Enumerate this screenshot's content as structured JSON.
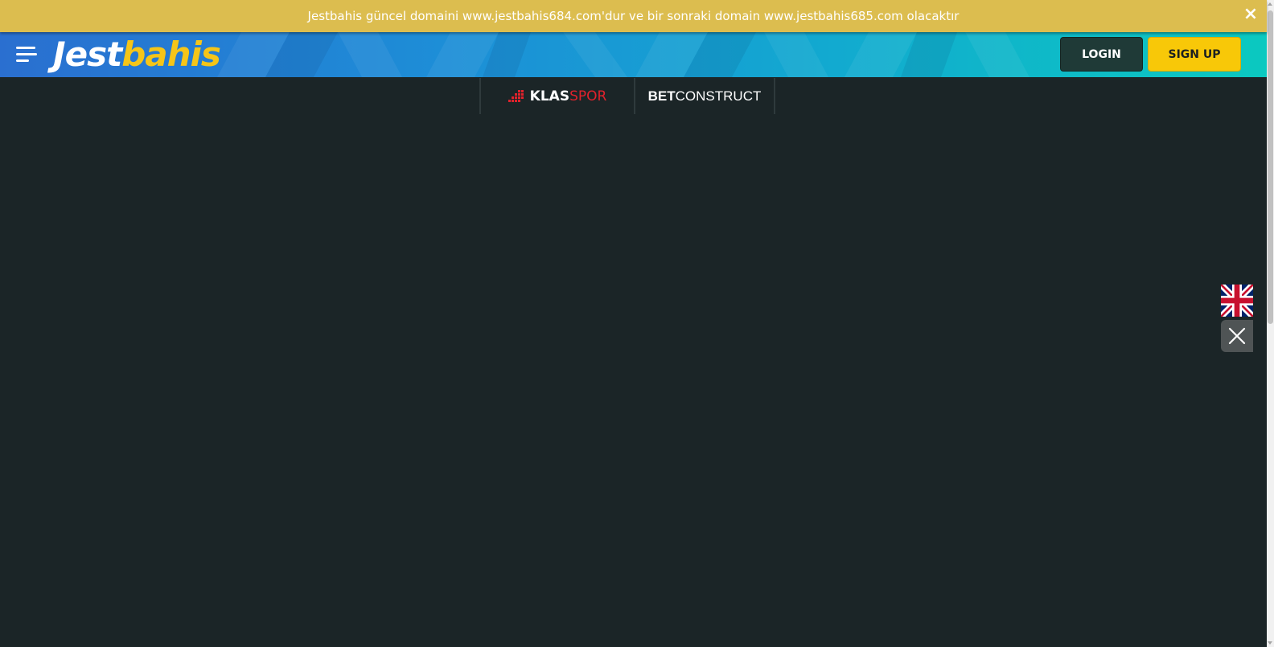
{
  "announcement": {
    "text": "Jestbahis güncel domaini www.jestbahis684.com'dur ve bir sonraki domain www.jestbahis685.com olacaktır",
    "close_icon": "×"
  },
  "header": {
    "logo_part1": "Jest",
    "logo_part2": "bahis",
    "login_label": "LOGIN",
    "signup_label": "SIGN UP"
  },
  "providers": {
    "klas_bold": "KLAS",
    "klas_light": "SPOR",
    "bc_bold": "BET",
    "bc_light": "CONSTRUCT"
  },
  "side": {
    "flag_icon": "uk-flag-icon",
    "close_icon": "close-icon"
  },
  "colors": {
    "background": "#1b2527",
    "announcement": "#dcbd4f",
    "signup": "#f8c808",
    "login": "#1f3a37"
  }
}
